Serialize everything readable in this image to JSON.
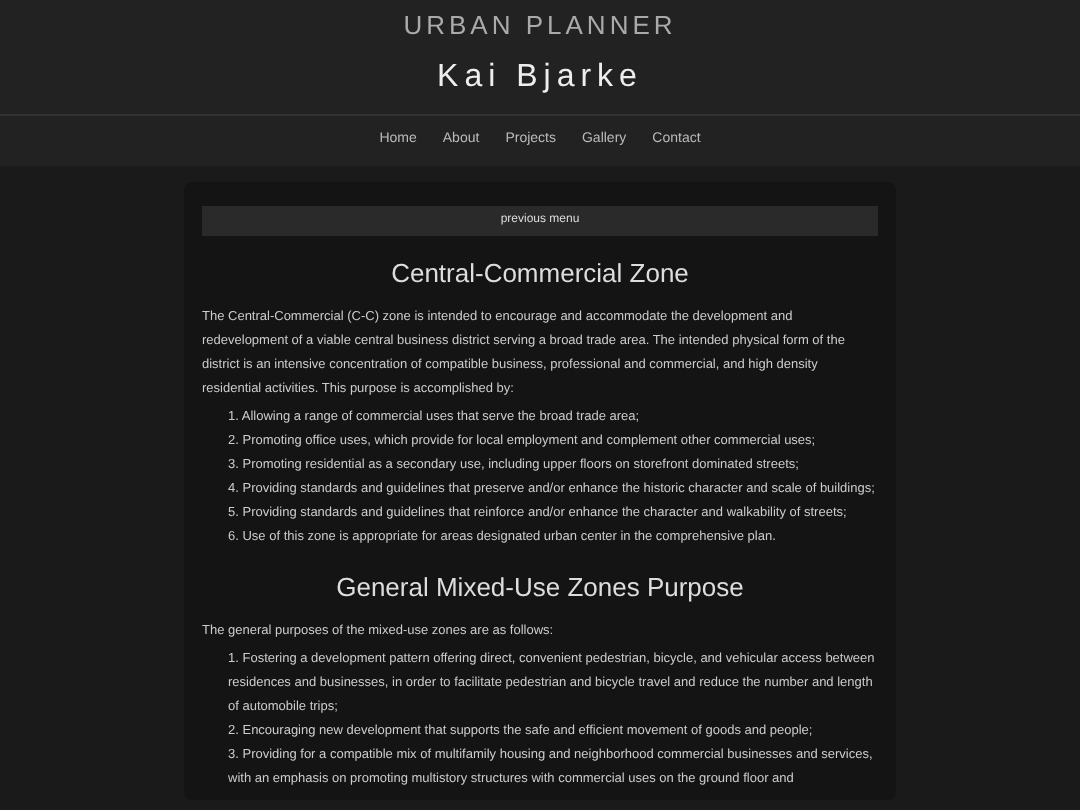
{
  "header": {
    "subtitle": "URBAN PLANNER",
    "title": "Kai Bjarke"
  },
  "nav": [
    {
      "label": "Home"
    },
    {
      "label": "About"
    },
    {
      "label": "Projects"
    },
    {
      "label": "Gallery"
    },
    {
      "label": "Contact"
    }
  ],
  "previous_menu": "previous menu",
  "sections": [
    {
      "heading": "Central-Commercial Zone",
      "intro": "The Central-Commercial (C-C) zone is intended to encourage and accommodate the development and redevelopment of a viable central business district serving a broad trade area. The intended physical form of the district is an intensive concentration of compatible business, professional and commercial, and high density residential activities. This purpose is accomplished by:",
      "items": [
        {
          "number": "1.",
          "text": "Allowing a range of commercial uses that serve the broad trade area;"
        },
        {
          "number": "2.",
          "text": "Promoting office uses, which provide for local employment and complement other commercial uses;"
        },
        {
          "number": "3.",
          "text": "Promoting residential as a secondary use, including upper floors on storefront dominated streets;"
        },
        {
          "number": "4.",
          "text": "Providing standards and guidelines that preserve and/or enhance the historic character and scale of buildings;"
        },
        {
          "number": "5.",
          "text": "Providing standards and guidelines that reinforce and/or enhance the character and walkability of streets;"
        },
        {
          "number": "6.",
          "text": "Use of this zone is appropriate for areas designated urban center in the comprehensive plan."
        }
      ]
    },
    {
      "heading": "General Mixed-Use Zones Purpose",
      "intro": "The general purposes of the mixed-use zones are as follows:",
      "items": [
        {
          "number": "1.",
          "text": "Fostering a development pattern offering direct, convenient pedestrian, bicycle, and vehicular access between residences and businesses, in order to facilitate pedestrian and bicycle travel and reduce the number and length of automobile trips;"
        },
        {
          "number": "2.",
          "text": "Encouraging new development that supports the safe and efficient movement of goods and people;"
        },
        {
          "number": "3.",
          "text": "Providing for a compatible mix of multifamily housing and neighborhood commercial businesses and services, with an emphasis on promoting multistory structures with commercial uses on the ground floor and"
        }
      ]
    }
  ]
}
